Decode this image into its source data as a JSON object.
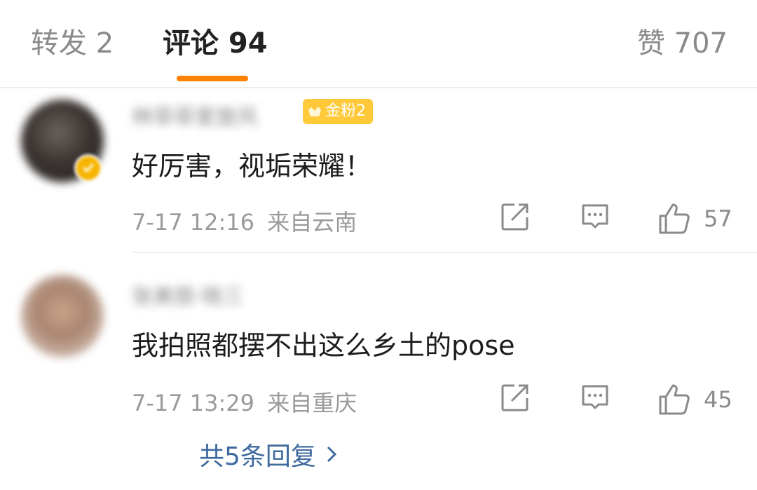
{
  "tabs": {
    "repost": "转发 2",
    "comment": "评论 94",
    "like": "赞 707"
  },
  "colors": {
    "accent": "#ff8200",
    "badge": "#ffc93a",
    "link": "#3f6a9e"
  },
  "comments": [
    {
      "username": "林菲菲爱旋风",
      "fan_badge": "金粉2",
      "verified_icon": "v-check-icon",
      "text": "好厉害，视垢荣耀！",
      "time": "7-17 12:16",
      "location": "来自云南",
      "likes": "57"
    },
    {
      "username": "张美丽·晓三",
      "text": "我拍照都摆不出这么乡土的pose",
      "time": "7-17 13:29",
      "location": "来自重庆",
      "likes": "45"
    }
  ],
  "replies_link": "共5条回复"
}
